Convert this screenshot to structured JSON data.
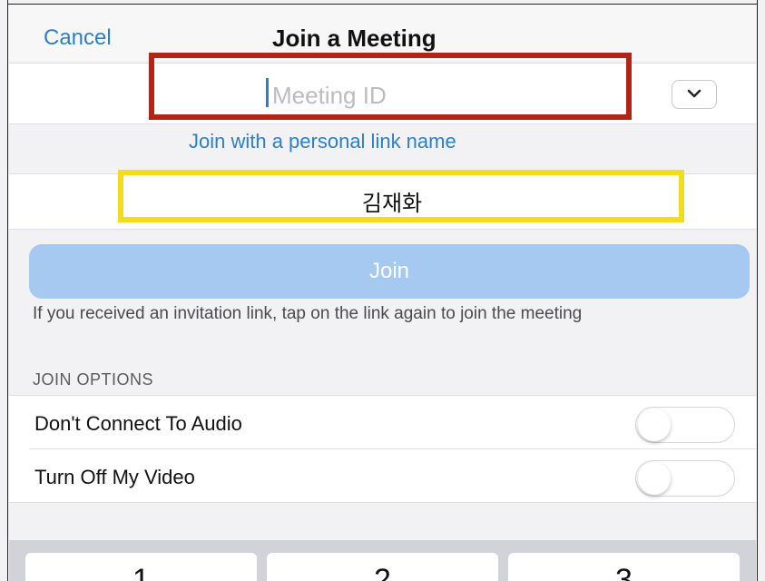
{
  "navbar": {
    "cancel_label": "Cancel",
    "title": "Join a Meeting"
  },
  "meeting_id": {
    "placeholder": "Meeting ID",
    "value": ""
  },
  "personal_link_label": "Join with a personal link name",
  "name_field": {
    "value": "김재화"
  },
  "join_button_label": "Join",
  "hint_text": "If you received an invitation link, tap on the link again to join the meeting",
  "join_options": {
    "section_label": "JOIN OPTIONS",
    "options": [
      {
        "label": "Don't Connect To Audio",
        "enabled": false
      },
      {
        "label": "Turn Off My Video",
        "enabled": false
      }
    ]
  },
  "keypad": {
    "keys": [
      "1",
      "2",
      "3"
    ]
  },
  "colors": {
    "accent": "#2d7fc8",
    "join_button_disabled": "#a6c9f2",
    "annotation_red": "#b22418",
    "annotation_yellow": "#f2dc1c"
  },
  "icons": {
    "dropdown": "chevron-down-icon"
  }
}
